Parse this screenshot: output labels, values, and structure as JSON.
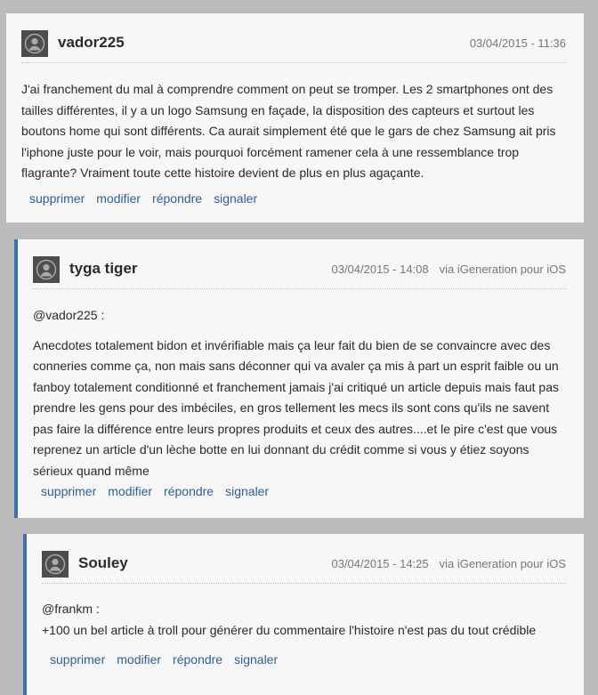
{
  "comments": [
    {
      "username": "vador225",
      "timestamp": "03/04/2015 - 11:36",
      "via": "",
      "mention": "",
      "text": "J'ai franchement du mal à comprendre comment on peut se tromper. Les 2 smartphones ont des tailles différentes, il y a un logo Samsung en façade, la disposition des capteurs et surtout les boutons home qui sont différents. Ca aurait simplement été que le gars de chez Samsung ait pris l'iphone juste pour le voir, mais pourquoi forcément ramener cela à une ressemblance trop flagrante? Vraiment toute cette histoire devient de plus en plus agaçante."
    },
    {
      "username": "tyga tiger",
      "timestamp": "03/04/2015 - 14:08",
      "via": "via iGeneration pour iOS",
      "mention": "@vador225 :",
      "text": "Anecdotes totalement bidon et invérifiable mais ça leur fait du bien de se convaincre avec des conneries comme ça, non mais sans déconner qui va avaler ça mis à part un esprit faible ou un fanboy totalement conditionné et franchement jamais j'ai critiqué un article depuis mais faut pas prendre les gens pour des imbéciles, en gros tellement les mecs ils sont cons qu'ils ne savent pas faire la différence entre leurs propres produits et ceux des autres....et le pire c'est que vous reprenez un article d'un lèche botte en lui donnant du crédit comme si vous y étiez soyons sérieux quand même"
    },
    {
      "username": "Souley",
      "timestamp": "03/04/2015 - 14:25",
      "via": "via iGeneration pour iOS",
      "mention": "@frankm :",
      "text": "+100 un bel article à troll pour générer du commentaire l'histoire n'est pas du tout crédible"
    }
  ],
  "actions": {
    "delete": "supprimer",
    "edit": "modifier",
    "reply": "répondre",
    "report": "signaler"
  },
  "colors": {
    "background": "#bcbcbc",
    "card": "#f7f7f7",
    "link": "#2d5f97",
    "reply_accent": "#3d6fa8",
    "avatar": "#4d4d4d"
  },
  "icons": {
    "avatar": "user-silhouette-icon"
  }
}
